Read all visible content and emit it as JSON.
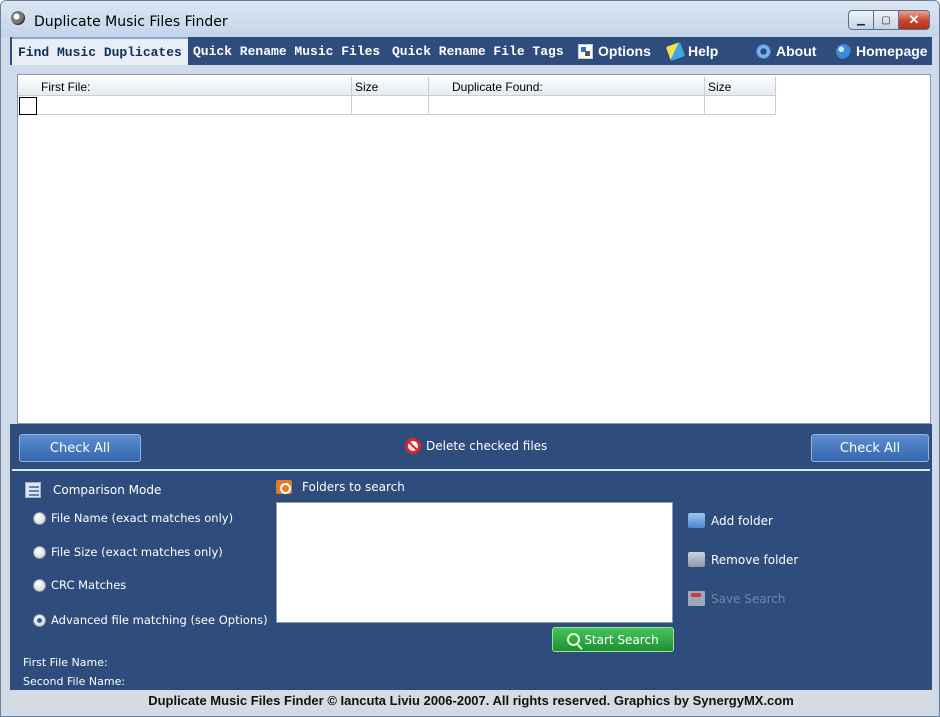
{
  "window": {
    "title": "Duplicate Music Files Finder",
    "controls": {
      "minimize": "▁",
      "maximize": "▢",
      "close": "✕"
    }
  },
  "menu": {
    "tabs": [
      {
        "label": "Find Music Duplicates",
        "active": true
      },
      {
        "label": "Quick Rename Music Files",
        "active": false
      },
      {
        "label": "Quick Rename File Tags",
        "active": false
      }
    ],
    "links": [
      {
        "label": "Options",
        "icon": "options-icon"
      },
      {
        "label": "Help",
        "icon": "help-icon"
      },
      {
        "label": "About",
        "icon": "about-icon"
      },
      {
        "label": "Homepage",
        "icon": "homepage-icon"
      }
    ]
  },
  "results": {
    "columns": [
      "First File:",
      "Size",
      "Duplicate Found:",
      "Size"
    ],
    "rows": []
  },
  "actions": {
    "check_all_left": "Check All",
    "delete_checked": "Delete checked files",
    "check_all_right": "Check All"
  },
  "comparison": {
    "title": "Comparison Mode",
    "options": [
      {
        "label": "File Name (exact matches only)",
        "selected": false
      },
      {
        "label": "File Size (exact matches only)",
        "selected": false
      },
      {
        "label": "CRC Matches",
        "selected": false
      },
      {
        "label": "Advanced file matching (see Options)",
        "selected": true
      }
    ]
  },
  "folders": {
    "title": "Folders to search",
    "add": "Add folder",
    "remove": "Remove folder",
    "save": "Save Search",
    "start": "Start Search"
  },
  "info": {
    "first_file_name": "First File Name:",
    "second_file_name": "Second File Name:"
  },
  "footer": "Duplicate Music Files Finder © Iancuta Liviu 2006-2007. All rights reserved. Graphics by SynergyMX.com",
  "colors": {
    "panel": "#2e4c7c",
    "accent_green": "#2ea845",
    "delete_red": "#e0242b"
  }
}
